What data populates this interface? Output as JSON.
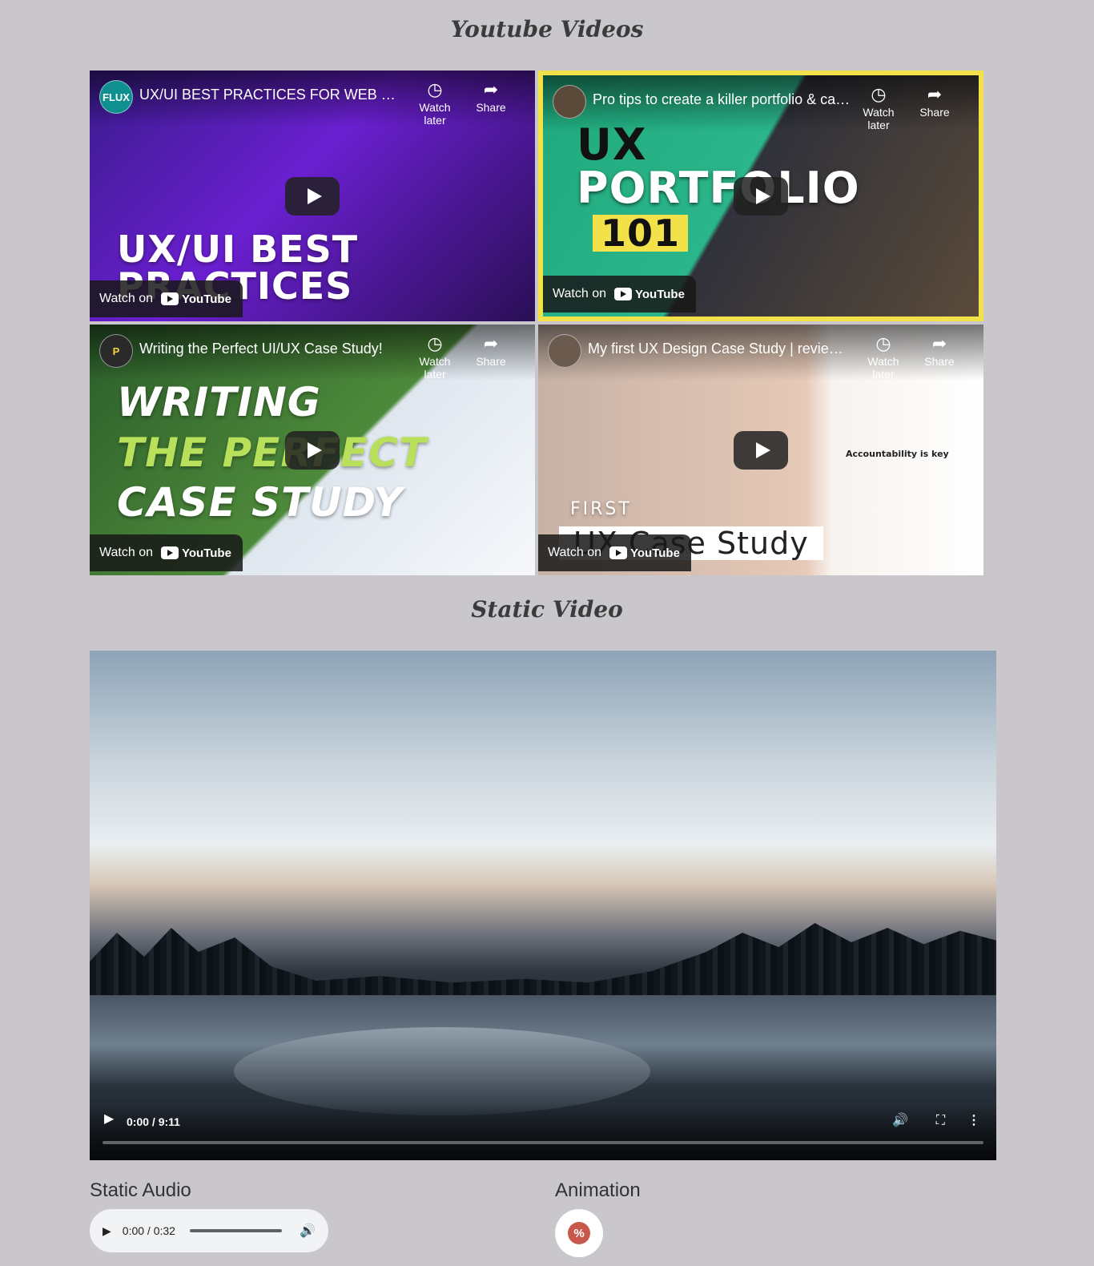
{
  "sections": {
    "youtube_title": "Youtube Videos",
    "static_video_title": "Static Video",
    "static_audio_title": "Static Audio",
    "animation_title": "Animation"
  },
  "youtube": {
    "watch_later_label": "Watch later",
    "share_label": "Share",
    "watch_on_label": "Watch on",
    "youtube_brand": "YouTube",
    "videos": [
      {
        "channel_initials": "FLUX",
        "title": "UX/UI BEST PRACTICES FOR WEB DESI…",
        "thumb_lines": [
          "UX/UI BEST",
          "PRACTICES"
        ]
      },
      {
        "channel_initials": "",
        "title": "Pro tips to create a killer portfolio & cas…",
        "thumb_lines": [
          "UX",
          "PORTFOLIO",
          "101"
        ]
      },
      {
        "channel_initials": "P",
        "title": "Writing the Perfect UI/UX Case Study!",
        "thumb_lines": [
          "WRITING",
          "THE PERFECT",
          "CASE STUDY"
        ]
      },
      {
        "channel_initials": "",
        "title": "My first UX Design Case Study | review…",
        "thumb_lines": [
          "FIRST",
          "UX Case Study",
          "Accountability is key"
        ]
      }
    ]
  },
  "static_video": {
    "time": "0:00 / 9:11",
    "progress": 0,
    "play_icon": "play-icon",
    "volume_icon": "volume-icon",
    "fullscreen_icon": "fullscreen-icon",
    "menu_icon": "more-vertical-icon"
  },
  "static_audio": {
    "time": "0:00 / 0:32",
    "progress": 0
  },
  "animation": {
    "badge_icon": "percent-badge-icon",
    "badge_color": "#c8584b"
  }
}
